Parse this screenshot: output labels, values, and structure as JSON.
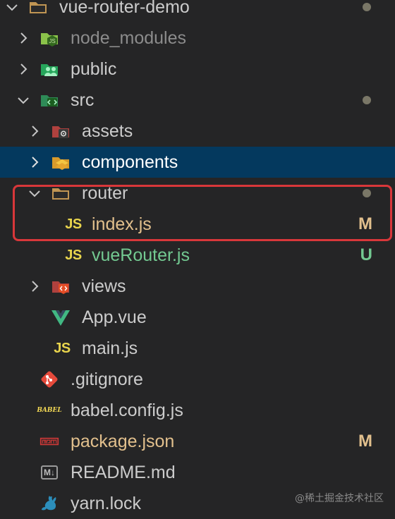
{
  "explorer": {
    "root": {
      "label": "vue-router-demo",
      "icon": "folder-icon"
    },
    "items": [
      {
        "label": "node_modules",
        "icon": "node-folder-icon"
      },
      {
        "label": "public",
        "icon": "public-folder-icon"
      },
      {
        "label": "src",
        "icon": "src-folder-icon"
      },
      {
        "label": "assets",
        "icon": "assets-folder-icon"
      },
      {
        "label": "components",
        "icon": "components-folder-icon"
      },
      {
        "label": "router",
        "icon": "folder-icon"
      },
      {
        "label": "index.js",
        "icon": "javascript-icon",
        "status": "M"
      },
      {
        "label": "vueRouter.js",
        "icon": "javascript-icon",
        "status": "U"
      },
      {
        "label": "views",
        "icon": "views-folder-icon"
      },
      {
        "label": "App.vue",
        "icon": "vue-icon"
      },
      {
        "label": "main.js",
        "icon": "javascript-icon"
      },
      {
        "label": ".gitignore",
        "icon": "git-icon"
      },
      {
        "label": "babel.config.js",
        "icon": "babel-icon"
      },
      {
        "label": "package.json",
        "icon": "npm-icon",
        "status": "M"
      },
      {
        "label": "README.md",
        "icon": "markdown-icon"
      },
      {
        "label": "yarn.lock",
        "icon": "yarn-icon"
      }
    ],
    "js_glyph": "JS",
    "markdown_glyph": "M↓",
    "babel_glyph": "BABEL"
  },
  "watermark": "@稀土掘金技术社区",
  "colors": {
    "background": "#252526",
    "selected_row": "#04395e",
    "highlight_border": "#d8373a",
    "modified": "#e2c08d",
    "untracked": "#73c991"
  }
}
